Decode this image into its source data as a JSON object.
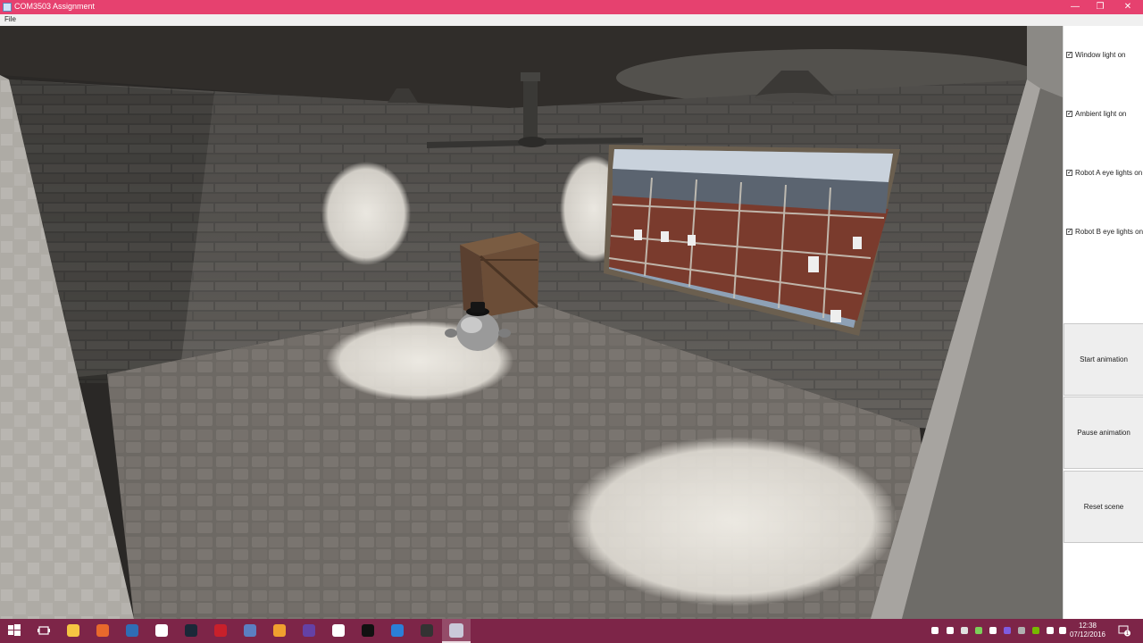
{
  "window": {
    "title": "COM3503 Assignment",
    "minimize_glyph": "—",
    "restore_glyph": "❐",
    "close_glyph": "✕"
  },
  "menu": {
    "items": [
      {
        "label": "File"
      }
    ]
  },
  "panel": {
    "checkboxes": [
      {
        "label": "Window light on",
        "checked": true,
        "mark": "✓"
      },
      {
        "label": "Ambient light on",
        "checked": true,
        "mark": "✓"
      },
      {
        "label": "Robot A eye lights on",
        "checked": true,
        "mark": "✓"
      },
      {
        "label": "Robot B eye lights on",
        "checked": true,
        "mark": "✓"
      }
    ],
    "buttons": [
      {
        "label": "Start animation"
      },
      {
        "label": "Pause animation"
      },
      {
        "label": "Reset scene"
      }
    ]
  },
  "taskbar": {
    "clock_time": "12:38",
    "clock_date": "07/12/2016",
    "notification_count": "1",
    "apps": [
      {
        "icon": "windows-start-icon",
        "color": "#ffffff"
      },
      {
        "icon": "task-view-icon",
        "color": "#ffffff"
      },
      {
        "icon": "file-explorer-icon",
        "color": "#f5c542"
      },
      {
        "icon": "firefox-icon",
        "color": "#e8692c"
      },
      {
        "icon": "thunderbird-icon",
        "color": "#2f6db5"
      },
      {
        "icon": "mask-app-icon",
        "color": "#ffffff"
      },
      {
        "icon": "steam-icon",
        "color": "#1b2838"
      },
      {
        "icon": "filezilla-icon",
        "color": "#c8202b"
      },
      {
        "icon": "network-tool-icon",
        "color": "#5b7fc2"
      },
      {
        "icon": "git-icon",
        "color": "#f0a02f"
      },
      {
        "icon": "twitch-icon",
        "color": "#6441a5"
      },
      {
        "icon": "game-app-icon",
        "color": "#ffffff"
      },
      {
        "icon": "terminal-icon",
        "color": "#111111"
      },
      {
        "icon": "visual-studio-code-icon",
        "color": "#2b7fd8"
      },
      {
        "icon": "obs-icon",
        "color": "#333333"
      },
      {
        "icon": "java-app-icon",
        "color": "#c9c9d9"
      }
    ]
  },
  "colors": {
    "title_bar": "#e6416f",
    "taskbar": "#7d2548"
  }
}
